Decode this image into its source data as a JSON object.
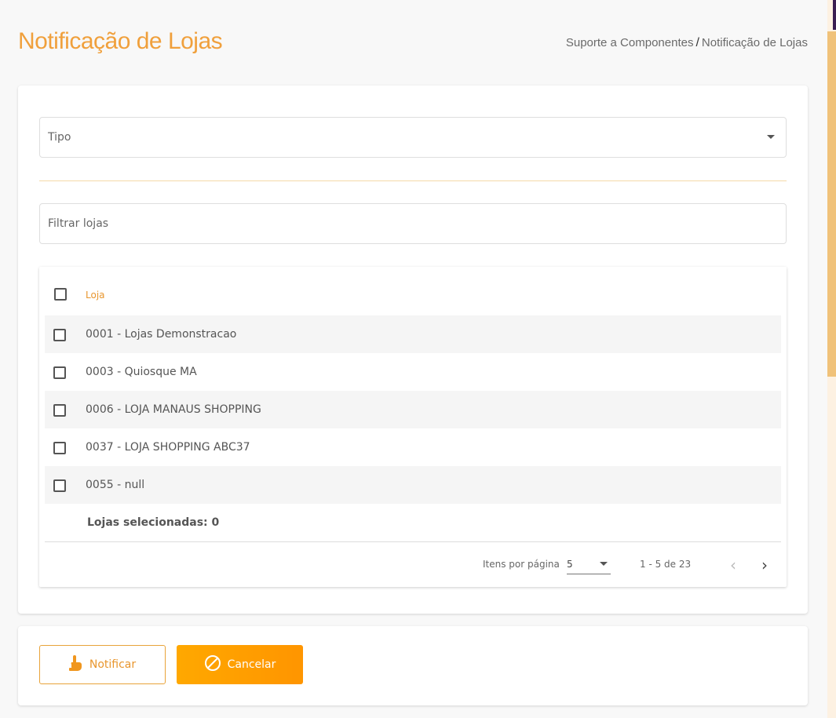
{
  "header": {
    "title": "Notificação de Lojas",
    "breadcrumb": {
      "parent": "Suporte a Componentes",
      "separator": "/",
      "current": "Notificação de Lojas"
    }
  },
  "form": {
    "tipo": {
      "label": "Tipo",
      "value": ""
    },
    "filter": {
      "placeholder": "Filtrar lojas",
      "value": ""
    }
  },
  "table": {
    "header": {
      "column": "Loja"
    },
    "rows": [
      {
        "label": "0001 - Lojas Demonstracao"
      },
      {
        "label": "0003 - Quiosque MA"
      },
      {
        "label": "0006 - LOJA MANAUS SHOPPING"
      },
      {
        "label": "0037 - LOJA SHOPPING ABC37"
      },
      {
        "label": "0055 - null"
      }
    ],
    "selected_count": "Lojas selecionadas: 0"
  },
  "paginator": {
    "items_per_page_label": "Itens por página",
    "page_size": "5",
    "range_label": "1 - 5 de 23",
    "prev_icon": "‹",
    "next_icon": "›"
  },
  "actions": {
    "notify_label": "Notificar",
    "cancel_label": "Cancelar"
  },
  "colors": {
    "accent": "#f0a03c",
    "primary_button": "#ffa000",
    "scroll_thumb": "#f0c27a"
  },
  "icons": {
    "notify": "hand-pointer-icon",
    "cancel": "block-icon",
    "select_caret": "caret-down-icon"
  }
}
